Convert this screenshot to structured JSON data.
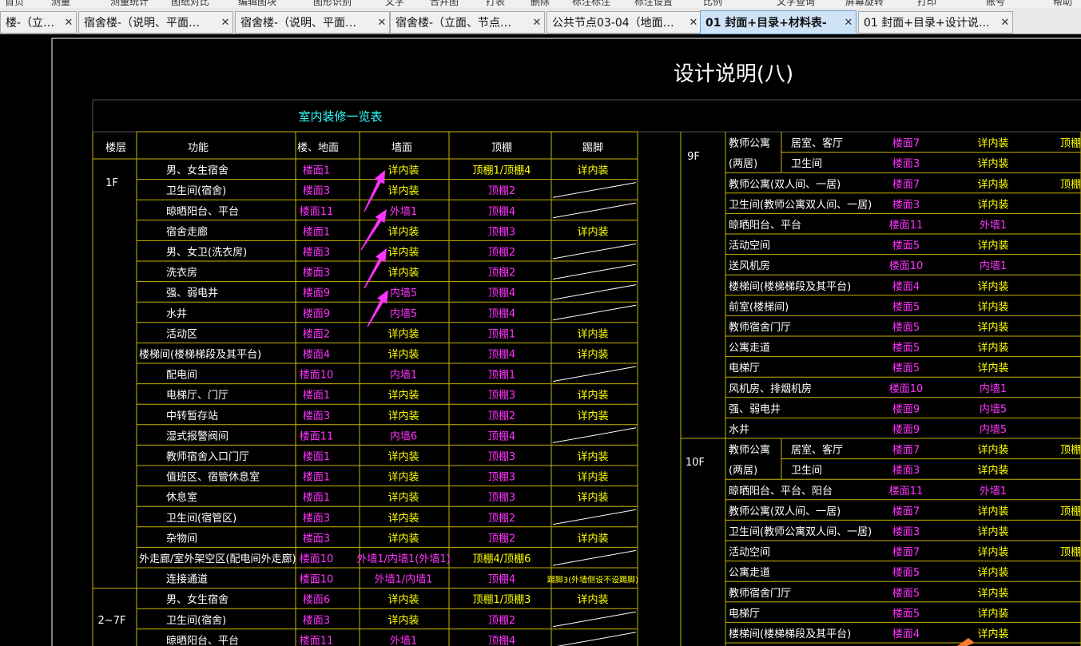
{
  "menu": [
    "首页",
    "测量",
    "测量统计",
    "图纸对比",
    "编辑图块",
    "图形识别",
    "文字",
    "合并图",
    "打表",
    "删除",
    "标注标注",
    "标注设置",
    "比例",
    "文字查询",
    "屏幕旋转",
    "打印",
    "账号",
    "帮助"
  ],
  "tabs": [
    {
      "label": "楼-（立…",
      "active": false
    },
    {
      "label": "宿舍楼-（说明、平面…",
      "active": false
    },
    {
      "label": "宿舍楼-（说明、平面…",
      "active": false
    },
    {
      "label": "宿舍楼-（立面、节点…",
      "active": false
    },
    {
      "label": "公共节点03-04（地面…",
      "active": false
    },
    {
      "label": "01 封面+目录+材料表-",
      "active": true
    },
    {
      "label": "01 封面+目录+设计说…",
      "active": false
    }
  ],
  "close_glyph": "✕",
  "drawing": {
    "title": "设计说明(八)",
    "table_title": "室内装修一览表",
    "headers": [
      "楼层",
      "功能",
      "楼、地面",
      "墙面",
      "顶棚",
      "踢脚"
    ],
    "floors": [
      "1F",
      "2~7F"
    ],
    "left_rows": [
      {
        "func": "男、女生宿舍",
        "floor": "楼面1",
        "wall": "详内装",
        "ceiling": "顶棚1/顶棚4",
        "skirt": "详内装"
      },
      {
        "func": "卫生间(宿舍)",
        "floor": "楼面3",
        "wall": "详内装",
        "ceiling": "顶棚2",
        "skirt": ""
      },
      {
        "func": "晾晒阳台、平台",
        "floor": "楼面11",
        "wall": "外墙1",
        "ceiling": "顶棚4",
        "skirt": ""
      },
      {
        "func": "宿舍走廊",
        "floor": "楼面1",
        "wall": "详内装",
        "ceiling": "顶棚3",
        "skirt": "详内装"
      },
      {
        "func": "男、女卫(洗衣房)",
        "floor": "楼面3",
        "wall": "详内装",
        "ceiling": "顶棚2",
        "skirt": ""
      },
      {
        "func": "洗衣房",
        "floor": "楼面3",
        "wall": "详内装",
        "ceiling": "顶棚2",
        "skirt": ""
      },
      {
        "func": "强、弱电井",
        "floor": "楼面9",
        "wall": "内墙5",
        "ceiling": "顶棚4",
        "skirt": ""
      },
      {
        "func": "水井",
        "floor": "楼面9",
        "wall": "内墙5",
        "ceiling": "顶棚4",
        "skirt": ""
      },
      {
        "func": "活动区",
        "floor": "楼面2",
        "wall": "详内装",
        "ceiling": "顶棚1",
        "skirt": "详内装"
      },
      {
        "func": "楼梯间(楼梯梯段及其平台)",
        "floor": "楼面4",
        "wall": "详内装",
        "ceiling": "顶棚4",
        "skirt": "详内装"
      },
      {
        "func": "配电间",
        "floor": "楼面10",
        "wall": "内墙1",
        "ceiling": "顶棚1",
        "skirt": ""
      },
      {
        "func": "电梯厅、门厅",
        "floor": "楼面1",
        "wall": "详内装",
        "ceiling": "顶棚3",
        "skirt": "详内装"
      },
      {
        "func": "中转暂存站",
        "floor": "楼面3",
        "wall": "详内装",
        "ceiling": "顶棚2",
        "skirt": "详内装"
      },
      {
        "func": "湿式报警阀间",
        "floor": "楼面11",
        "wall": "内墙6",
        "ceiling": "顶棚4",
        "skirt": ""
      },
      {
        "func": "教师宿舍入口门厅",
        "floor": "楼面1",
        "wall": "详内装",
        "ceiling": "顶棚3",
        "skirt": "详内装"
      },
      {
        "func": "值班区、宿管休息室",
        "floor": "楼面1",
        "wall": "详内装",
        "ceiling": "顶棚3",
        "skirt": "详内装"
      },
      {
        "func": "休息室",
        "floor": "楼面1",
        "wall": "详内装",
        "ceiling": "顶棚3",
        "skirt": "详内装"
      },
      {
        "func": "卫生间(宿管区)",
        "floor": "楼面3",
        "wall": "详内装",
        "ceiling": "顶棚2",
        "skirt": ""
      },
      {
        "func": "杂物间",
        "floor": "楼面3",
        "wall": "详内装",
        "ceiling": "顶棚2",
        "skirt": "详内装"
      },
      {
        "func": "外走廊/室外架空区(配电间外走廊)",
        "floor": "楼面10",
        "wall": "外墙1/内墙1(外墙1)",
        "ceiling": "顶棚4/顶棚6",
        "skirt": ""
      },
      {
        "func": "连接通道",
        "floor": "楼面10",
        "wall": "外墙1/内墙1",
        "ceiling": "顶棚4",
        "skirt": "踢脚3(外墙侧设不设踢脚)"
      },
      {
        "func": "男、女生宿舍",
        "floor": "楼面6",
        "wall": "详内装",
        "ceiling": "顶棚1/顶棚3",
        "skirt": "详内装"
      },
      {
        "func": "卫生间(宿舍)",
        "floor": "楼面3",
        "wall": "详内装",
        "ceiling": "顶棚2",
        "skirt": ""
      },
      {
        "func": "晾晒阳台、平台",
        "floor": "楼面11",
        "wall": "外墙1",
        "ceiling": "顶棚4",
        "skirt": ""
      }
    ],
    "right_floors": [
      "9F",
      "10F"
    ],
    "right_rows": [
      {
        "func": "教师公寓",
        "sub": "居室、客厅",
        "floor": "楼面7",
        "wall": "详内装",
        "ceiling": "顶棚"
      },
      {
        "func": "(两居)",
        "sub": "卫生间",
        "floor": "楼面3",
        "wall": "详内装",
        "ceiling": ""
      },
      {
        "func": "教师公寓(双人间、一居)",
        "sub": "",
        "floor": "楼面7",
        "wall": "详内装",
        "ceiling": "顶棚"
      },
      {
        "func": "卫生间(教师公寓双人间、一居)",
        "sub": "",
        "floor": "楼面3",
        "wall": "详内装",
        "ceiling": ""
      },
      {
        "func": "晾晒阳台、平台",
        "sub": "",
        "floor": "楼面11",
        "wall": "外墙1",
        "ceiling": ""
      },
      {
        "func": "活动空间",
        "sub": "",
        "floor": "楼面5",
        "wall": "详内装",
        "ceiling": ""
      },
      {
        "func": "送风机房",
        "sub": "",
        "floor": "楼面10",
        "wall": "内墙1",
        "ceiling": ""
      },
      {
        "func": "楼梯间(楼梯梯段及其平台)",
        "sub": "",
        "floor": "楼面4",
        "wall": "详内装",
        "ceiling": ""
      },
      {
        "func": "前室(楼梯间)",
        "sub": "",
        "floor": "楼面5",
        "wall": "详内装",
        "ceiling": ""
      },
      {
        "func": "教师宿舍门厅",
        "sub": "",
        "floor": "楼面5",
        "wall": "详内装",
        "ceiling": ""
      },
      {
        "func": "公寓走道",
        "sub": "",
        "floor": "楼面5",
        "wall": "详内装",
        "ceiling": ""
      },
      {
        "func": "电梯厅",
        "sub": "",
        "floor": "楼面5",
        "wall": "详内装",
        "ceiling": ""
      },
      {
        "func": "风机房、排烟机房",
        "sub": "",
        "floor": "楼面10",
        "wall": "内墙1",
        "ceiling": ""
      },
      {
        "func": "强、弱电井",
        "sub": "",
        "floor": "楼面9",
        "wall": "内墙5",
        "ceiling": ""
      },
      {
        "func": "水井",
        "sub": "",
        "floor": "楼面9",
        "wall": "内墙5",
        "ceiling": ""
      },
      {
        "func": "教师公寓",
        "sub": "居室、客厅",
        "floor": "楼面7",
        "wall": "详内装",
        "ceiling": "顶棚"
      },
      {
        "func": "(两居)",
        "sub": "卫生间",
        "floor": "楼面3",
        "wall": "详内装",
        "ceiling": ""
      },
      {
        "func": "晾晒阳台、平台、阳台",
        "sub": "",
        "floor": "楼面11",
        "wall": "外墙1",
        "ceiling": ""
      },
      {
        "func": "教师公寓(双人间、一居)",
        "sub": "",
        "floor": "楼面7",
        "wall": "详内装",
        "ceiling": "顶棚"
      },
      {
        "func": "卫生间(教师公寓双人间、一居)",
        "sub": "",
        "floor": "楼面3",
        "wall": "详内装",
        "ceiling": ""
      },
      {
        "func": "活动空间",
        "sub": "",
        "floor": "楼面7",
        "wall": "详内装",
        "ceiling": "顶棚"
      },
      {
        "func": "公寓走道",
        "sub": "",
        "floor": "楼面5",
        "wall": "详内装",
        "ceiling": ""
      },
      {
        "func": "教师宿舍门厅",
        "sub": "",
        "floor": "楼面5",
        "wall": "详内装",
        "ceiling": ""
      },
      {
        "func": "电梯厅",
        "sub": "",
        "floor": "楼面5",
        "wall": "详内装",
        "ceiling": ""
      },
      {
        "func": "楼梯间(楼梯梯段及其平台)",
        "sub": "",
        "floor": "楼面4",
        "wall": "详内装",
        "ceiling": ""
      }
    ]
  },
  "colors": {
    "frame": "#ffffff",
    "grid": "#c8b400",
    "text": "#ffffff",
    "magenta": "#ff33ff",
    "yellow": "#ffff00",
    "cyan": "#33ffff",
    "arrow": "#ff33ff"
  }
}
